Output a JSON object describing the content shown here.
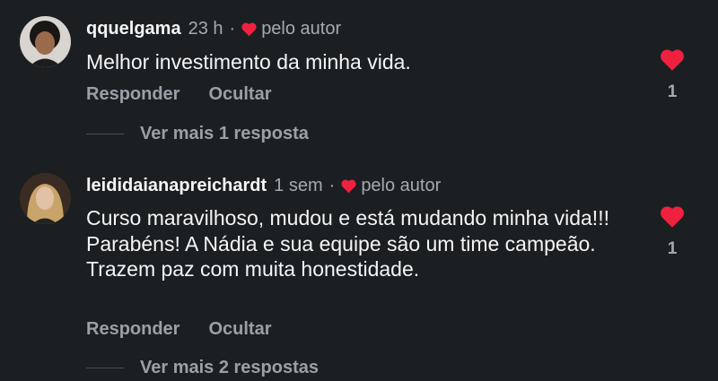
{
  "comments": [
    {
      "username": "qquelgama",
      "time": "23 h",
      "separator": "·",
      "author_badge": "pelo autor",
      "text": "Melhor investimento da minha vida.",
      "reply_label": "Responder",
      "hide_label": "Ocultar",
      "likes": "1",
      "more_replies": "Ver mais 1 resposta"
    },
    {
      "username": "leididaianapreichardt",
      "time": "1 sem",
      "separator": "·",
      "author_badge": "pelo autor",
      "text": "Curso maravilhoso, mudou e está mudando minha vida!!! Parabéns! A Nádia  e sua equipe são um time campeão. Trazem paz com muita honestidade.",
      "reply_label": "Responder",
      "hide_label": "Ocultar",
      "likes": "1",
      "more_replies": "Ver mais 2 respostas"
    }
  ],
  "colors": {
    "background": "#1b1f22",
    "heart": "#f0213f",
    "muted": "#a4aab0"
  }
}
